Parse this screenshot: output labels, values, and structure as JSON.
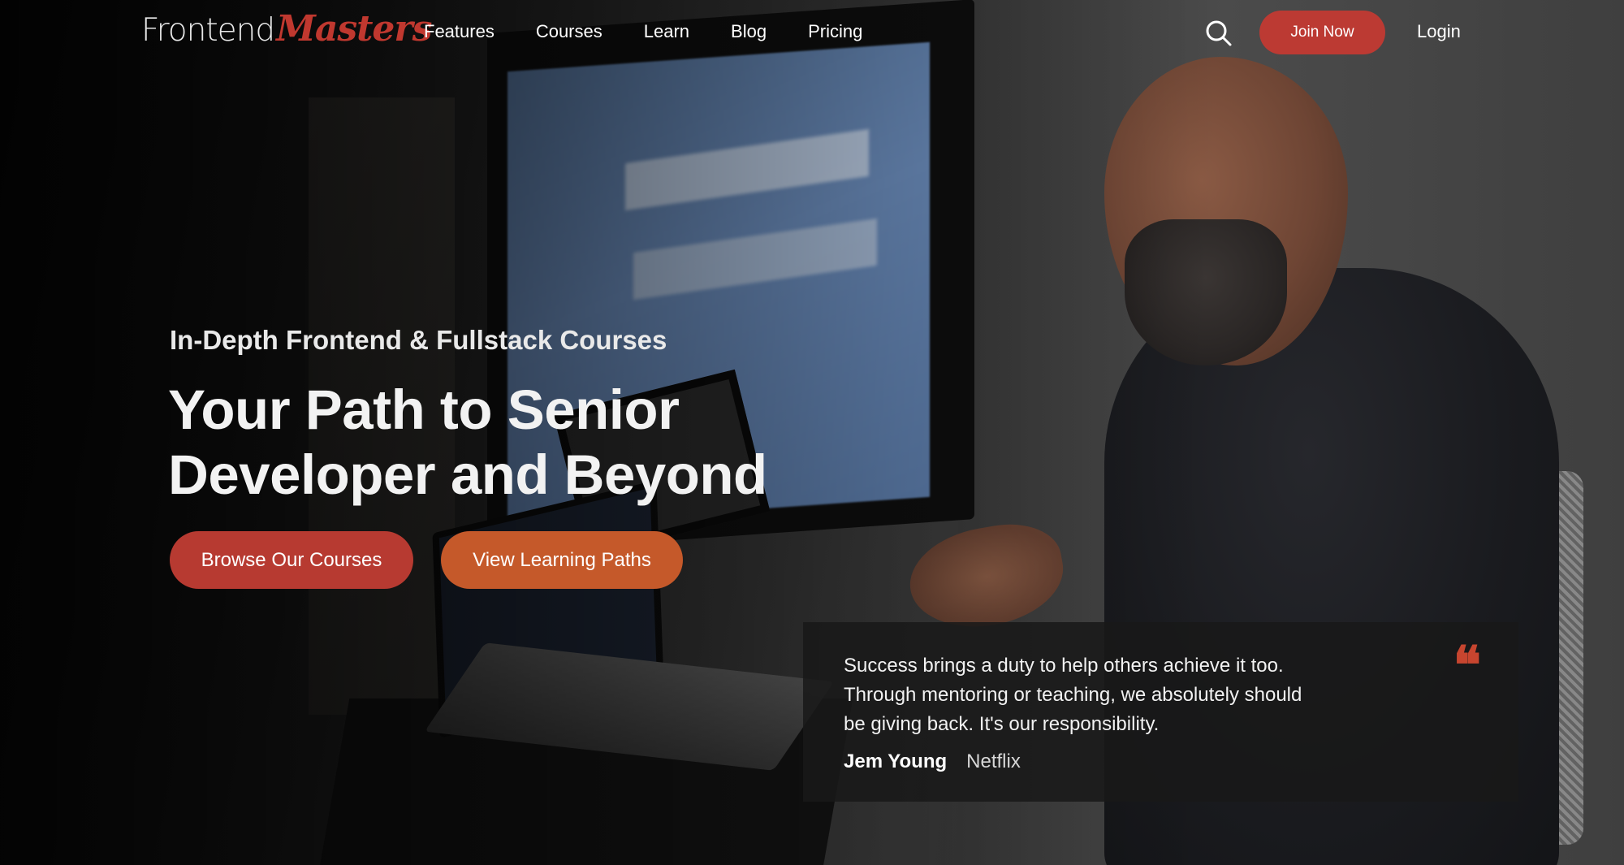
{
  "header": {
    "logo": {
      "part1": "Frontend",
      "part2": "Masters"
    },
    "nav": [
      {
        "label": "Features"
      },
      {
        "label": "Courses"
      },
      {
        "label": "Learn"
      },
      {
        "label": "Blog"
      },
      {
        "label": "Pricing"
      }
    ],
    "search_icon": "search-icon",
    "join_label": "Join Now",
    "login_label": "Login"
  },
  "hero": {
    "kicker": "In-Depth Frontend & Fullstack Courses",
    "title": "Your Path to Senior Developer and Beyond",
    "primary_cta": "Browse Our Courses",
    "secondary_cta": "View Learning Paths"
  },
  "testimonial": {
    "quote": "Success brings a duty to help others achieve it too. Through mentoring or teaching, we absolutely should be giving back. It's our responsibility.",
    "quote_mark": "❝",
    "author": "Jem Young",
    "company": "Netflix"
  },
  "colors": {
    "brand_red": "#bc3a33",
    "secondary_orange": "#c5592a",
    "quote_accent": "#c7452f"
  }
}
